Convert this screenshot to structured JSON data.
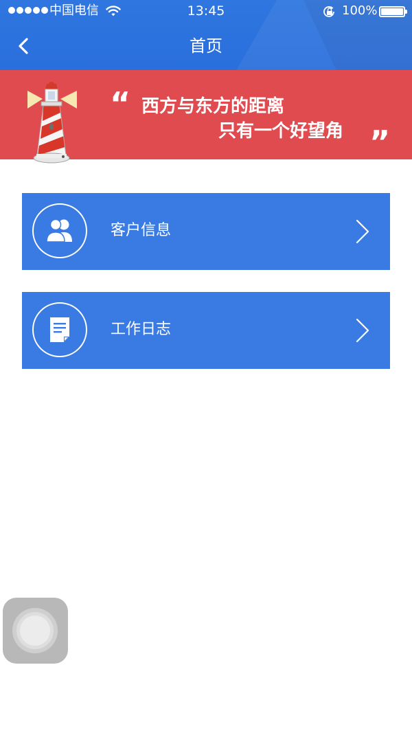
{
  "status_bar": {
    "carrier": "中国电信",
    "time": "13:45",
    "battery": "100%",
    "battery_level": 1.0,
    "signal_bars": 5,
    "icons": [
      "signal-dots-icon",
      "wifi-icon",
      "orientation-lock-icon",
      "battery-icon"
    ]
  },
  "nav": {
    "title": "首页",
    "back_icon": "chevron-left-icon"
  },
  "banner": {
    "quote_open": "“",
    "line1": "西方与东方的距离",
    "line2": "只有一个好望角",
    "quote_close": "”",
    "image": "lighthouse-icon"
  },
  "menu": [
    {
      "label": "客户信息",
      "icon": "customers-icon",
      "chevron": "chevron-right-icon"
    },
    {
      "label": "工作日志",
      "icon": "document-icon",
      "chevron": "chevron-right-icon"
    }
  ],
  "colors": {
    "header": "#2f76e0",
    "banner": "#e04b50",
    "card": "#3a7be3",
    "text_on_color": "#ffffff",
    "background": "#ffffff",
    "assistive_touch": "#b8b8b8"
  }
}
